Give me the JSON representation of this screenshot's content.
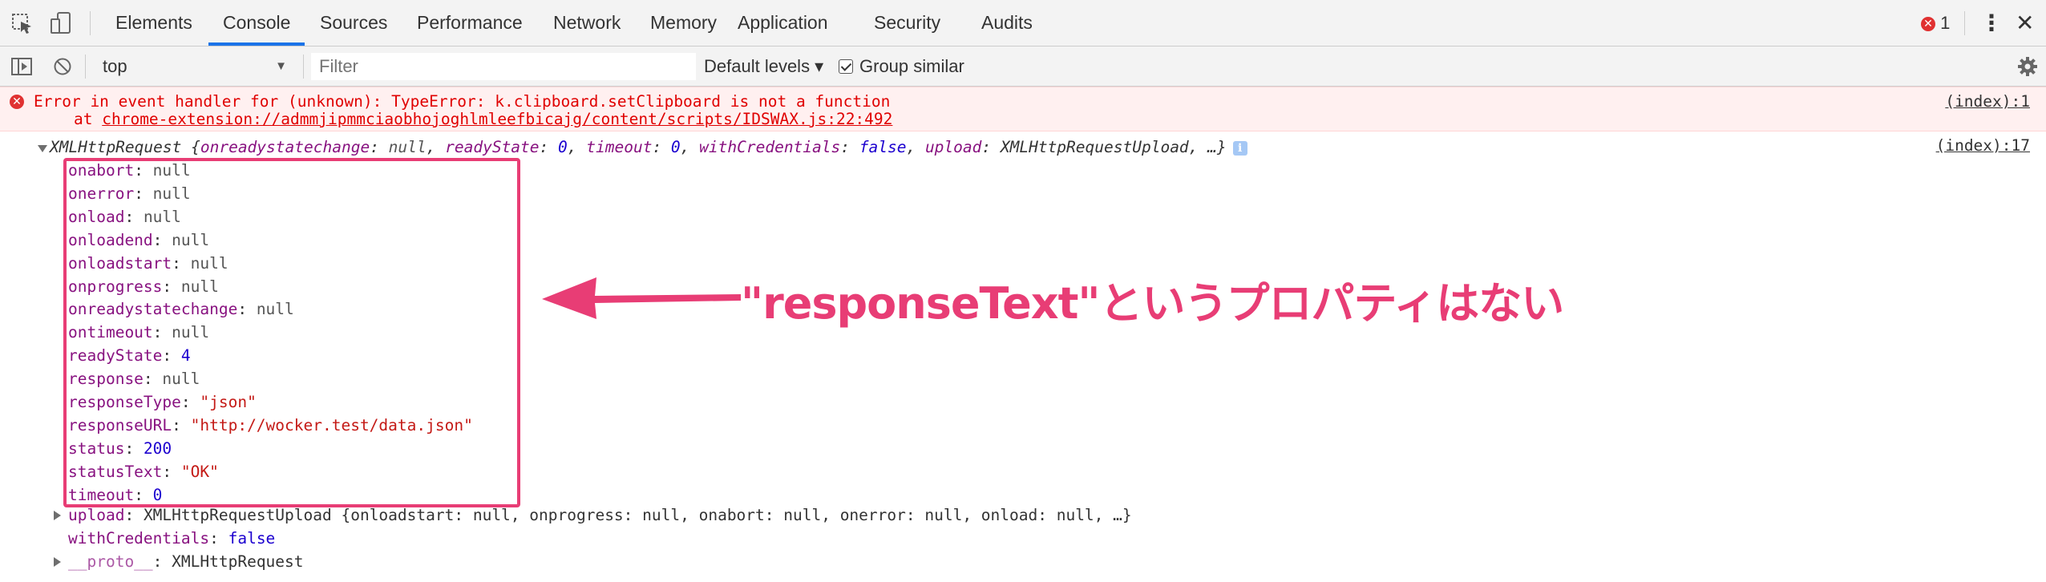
{
  "tabs": [
    {
      "label": "Elements",
      "active": false
    },
    {
      "label": "Console",
      "active": true
    },
    {
      "label": "Sources",
      "active": false
    },
    {
      "label": "Performance",
      "active": false
    },
    {
      "label": "Network",
      "active": false
    },
    {
      "label": "Memory",
      "active": false
    },
    {
      "label": "Application",
      "active": false
    },
    {
      "label": "Security",
      "active": false
    },
    {
      "label": "Audits",
      "active": false
    }
  ],
  "error_count": "1",
  "toolbar": {
    "context": "top",
    "filter_placeholder": "Filter",
    "levels_label": "Default levels ▾",
    "group_similar_label": "Group similar",
    "group_similar_checked": true
  },
  "error": {
    "message": "Error in event handler for (unknown): TypeError: k.clipboard.setClipboard is not a function",
    "at_prefix": "at ",
    "at_link": "chrome-extension://admmjipmmciaobhojoghlmleefbicajg/content/scripts/IDSWAX.js:22:492",
    "source": "(index):1"
  },
  "xhr": {
    "header_name": "XMLHttpRequest",
    "header_summary_parts": [
      {
        "t": " {",
        "c": "plain"
      },
      {
        "t": "onreadystatechange",
        "c": "key"
      },
      {
        "t": ": ",
        "c": "plain"
      },
      {
        "t": "null",
        "c": "null"
      },
      {
        "t": ", ",
        "c": "plain"
      },
      {
        "t": "readyState",
        "c": "key"
      },
      {
        "t": ": ",
        "c": "plain"
      },
      {
        "t": "0",
        "c": "num"
      },
      {
        "t": ", ",
        "c": "plain"
      },
      {
        "t": "timeout",
        "c": "key"
      },
      {
        "t": ": ",
        "c": "plain"
      },
      {
        "t": "0",
        "c": "num"
      },
      {
        "t": ", ",
        "c": "plain"
      },
      {
        "t": "withCredentials",
        "c": "key"
      },
      {
        "t": ": ",
        "c": "plain"
      },
      {
        "t": "false",
        "c": "num"
      },
      {
        "t": ", ",
        "c": "plain"
      },
      {
        "t": "upload",
        "c": "key"
      },
      {
        "t": ": XMLHttpRequestUpload, …}",
        "c": "plain"
      }
    ],
    "source": "(index):17",
    "properties": [
      {
        "name": "onabort",
        "value": "null",
        "type": "null"
      },
      {
        "name": "onerror",
        "value": "null",
        "type": "null"
      },
      {
        "name": "onload",
        "value": "null",
        "type": "null"
      },
      {
        "name": "onloadend",
        "value": "null",
        "type": "null"
      },
      {
        "name": "onloadstart",
        "value": "null",
        "type": "null"
      },
      {
        "name": "onprogress",
        "value": "null",
        "type": "null"
      },
      {
        "name": "onreadystatechange",
        "value": "null",
        "type": "null"
      },
      {
        "name": "ontimeout",
        "value": "null",
        "type": "null"
      },
      {
        "name": "readyState",
        "value": "4",
        "type": "num"
      },
      {
        "name": "response",
        "value": "null",
        "type": "null"
      },
      {
        "name": "responseType",
        "value": "\"json\"",
        "type": "str"
      },
      {
        "name": "responseURL",
        "value": "\"http://wocker.test/data.json\"",
        "type": "str"
      },
      {
        "name": "status",
        "value": "200",
        "type": "num"
      },
      {
        "name": "statusText",
        "value": "\"OK\"",
        "type": "str"
      },
      {
        "name": "timeout",
        "value": "0",
        "type": "num"
      }
    ],
    "upload_name": "upload",
    "upload_summary": "XMLHttpRequestUpload {onloadstart: null, onprogress: null, onabort: null, onerror: null, onload: null, …}",
    "withCredentials_name": "withCredentials",
    "withCredentials_value": "false",
    "proto_name": "__proto__",
    "proto_value": "XMLHttpRequest"
  },
  "annotation": {
    "text": "\"responseText\"というプロパティはない",
    "color": "#e83d75"
  },
  "colors": {
    "accent": "#1a73e8",
    "error_text": "#e00000",
    "error_bg": "#fff0f0",
    "prop_name": "#881280",
    "number": "#1c00cf",
    "string": "#c41a16",
    "highlight": "#e83d75"
  }
}
